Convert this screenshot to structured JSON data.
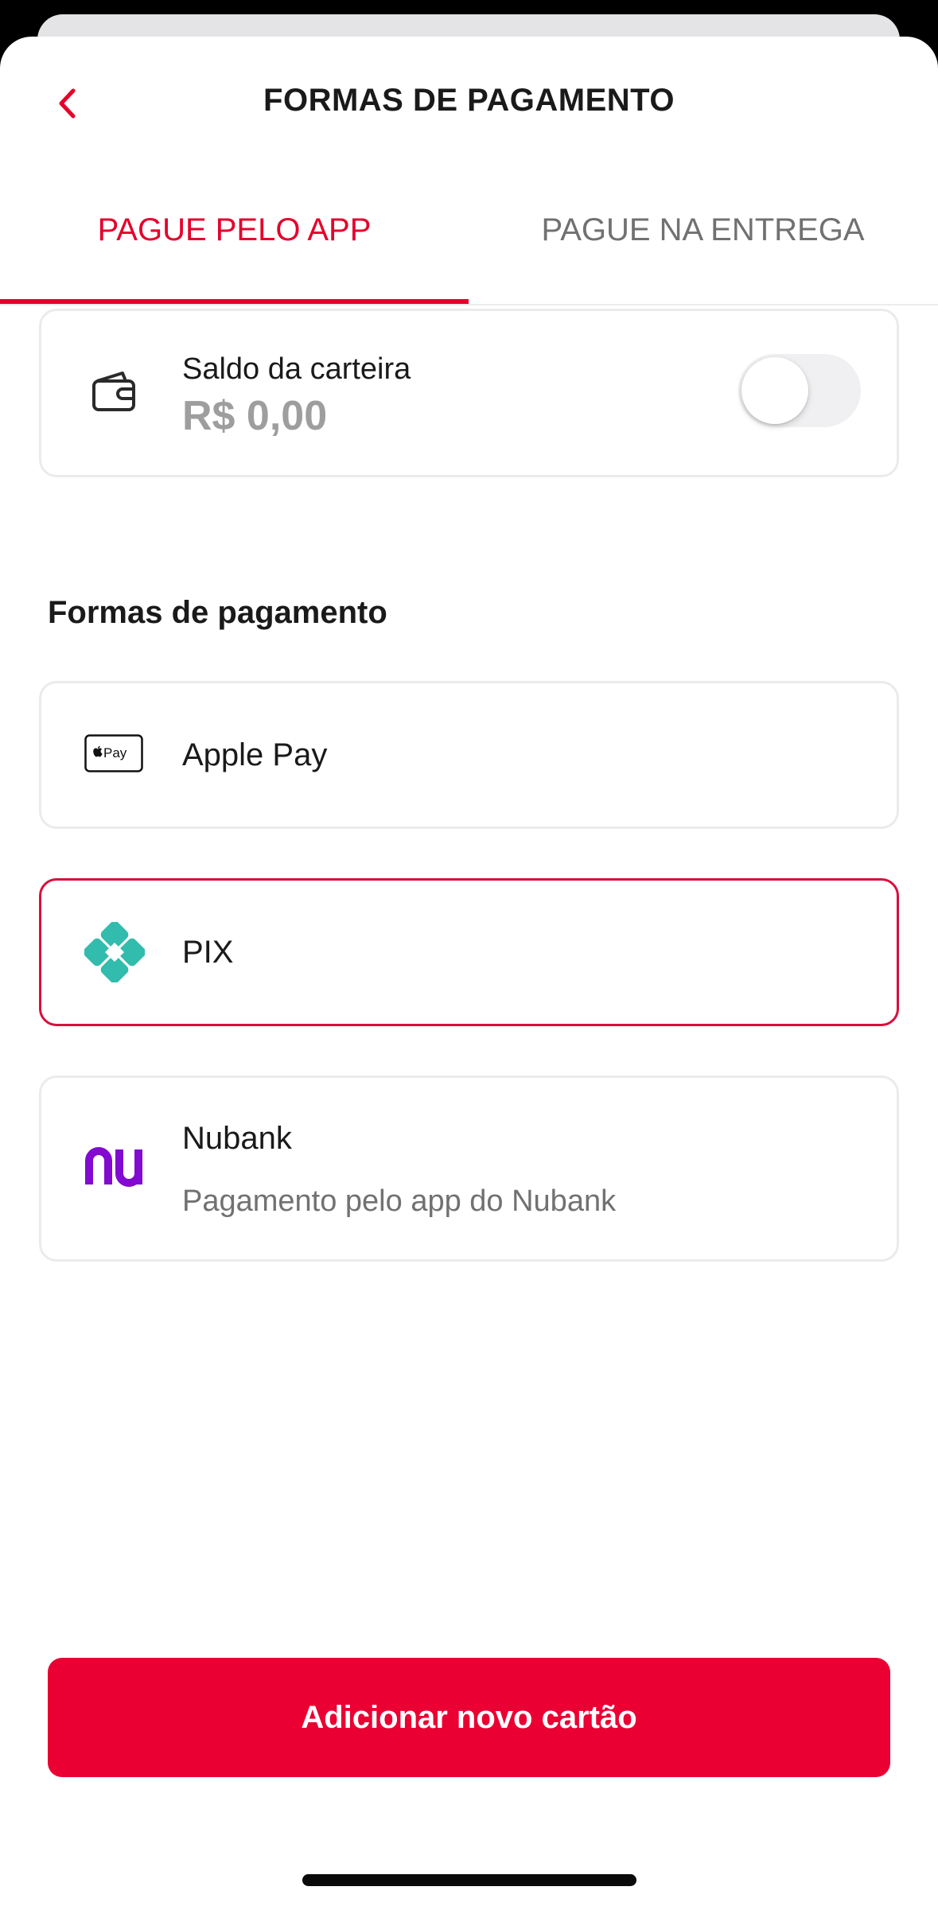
{
  "header": {
    "title": "FORMAS DE PAGAMENTO",
    "back_icon": "chevron-left-icon"
  },
  "tabs": [
    {
      "label": "PAGUE PELO APP",
      "active": true
    },
    {
      "label": "PAGUE NA ENTREGA",
      "active": false
    }
  ],
  "wallet": {
    "label": "Saldo da carteira",
    "value": "R$ 0,00",
    "toggle_on": false,
    "icon": "wallet-icon"
  },
  "section_title": "Formas de pagamento",
  "methods": [
    {
      "label": "Apple Pay",
      "icon": "apple-pay-icon",
      "icon_text": "Pay",
      "selected": false
    },
    {
      "label": "PIX",
      "icon": "pix-icon",
      "selected": true
    },
    {
      "label": "Nubank",
      "subtitle": "Pagamento pelo app do Nubank",
      "icon": "nubank-icon",
      "selected": false
    }
  ],
  "add_button": {
    "label": "Adicionar novo cartão"
  },
  "colors": {
    "accent": "#e4002b",
    "button": "#ea0033",
    "pix": "#32bcad",
    "nubank": "#820ad1"
  }
}
